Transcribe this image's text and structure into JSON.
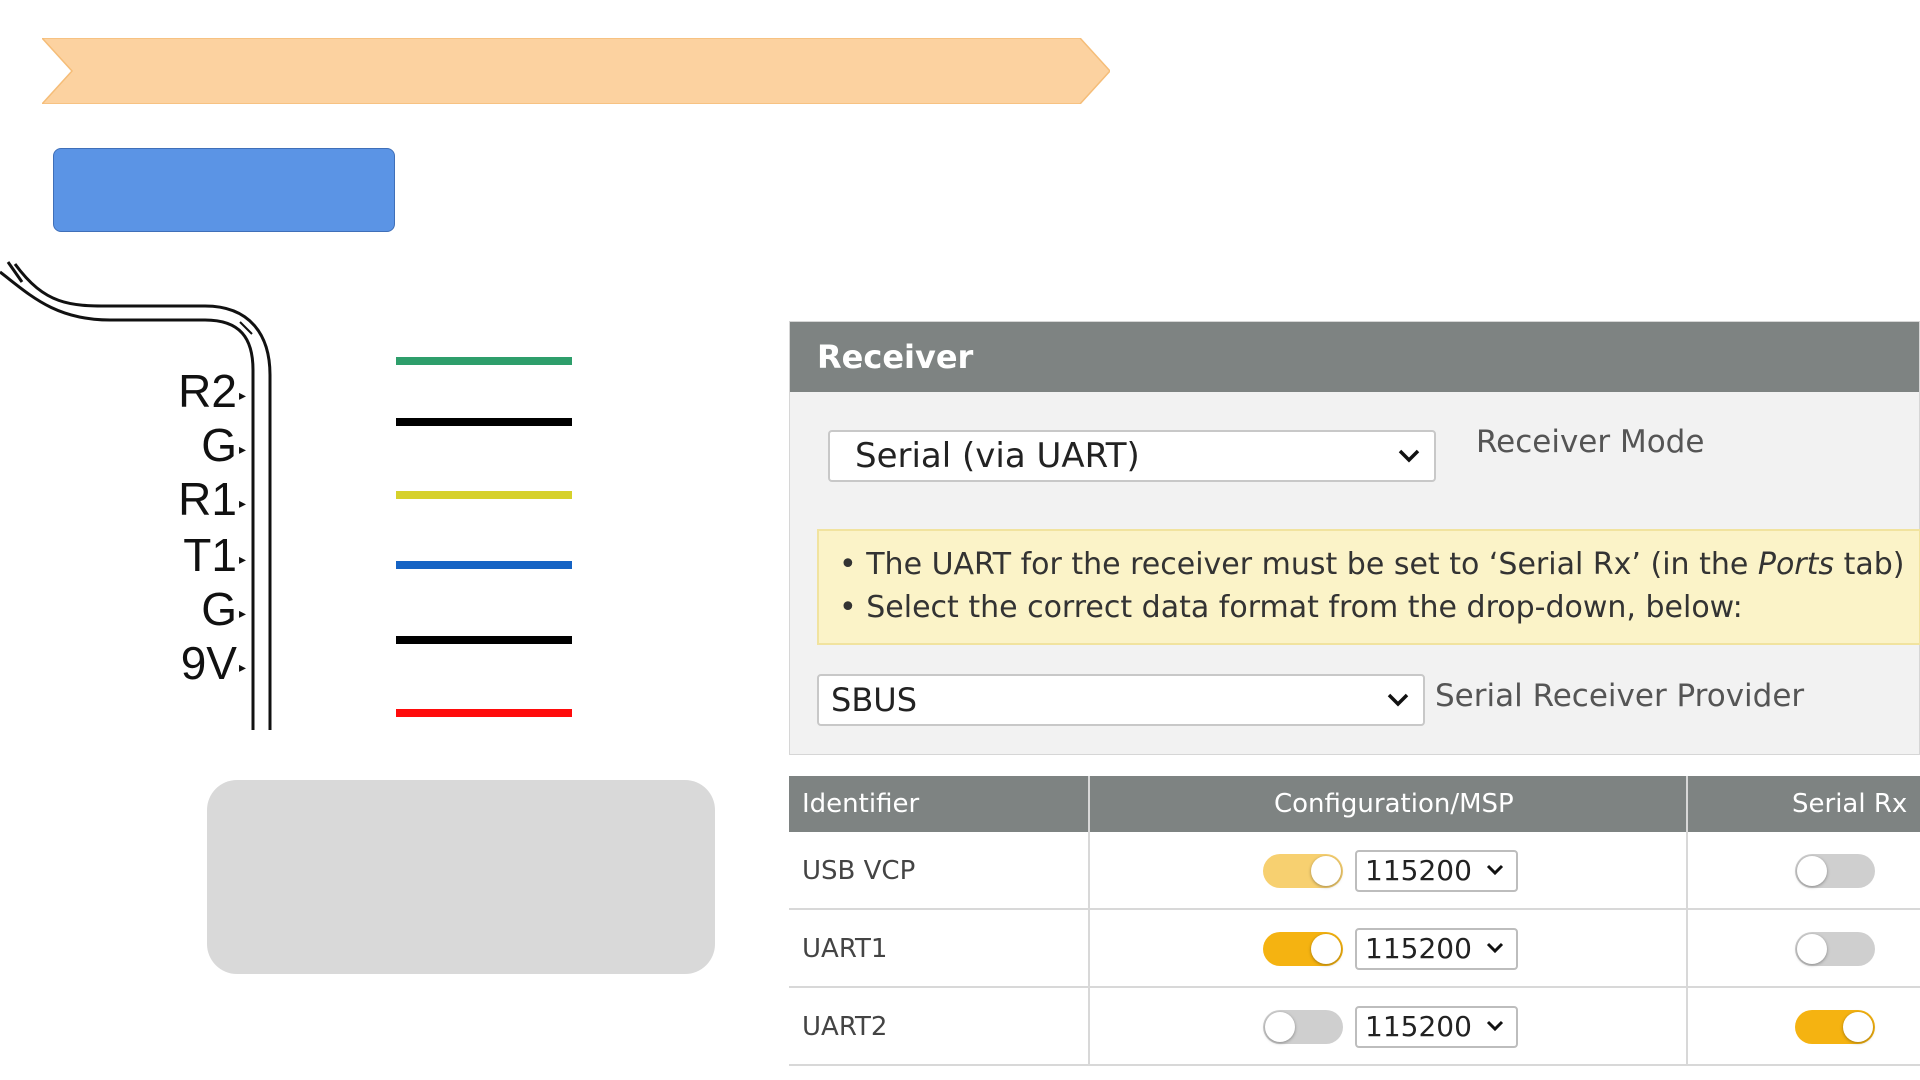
{
  "diagram": {
    "banner_color": "#fcd2a0",
    "blue_box_color": "#5b94e5",
    "gray_box_color": "#d9d9d9",
    "pins": [
      {
        "label": "R2",
        "arrow": "▸",
        "wire_color": "#2e9e6b"
      },
      {
        "label": "G",
        "arrow": "▸",
        "wire_color": "#000000"
      },
      {
        "label": "R1",
        "arrow": "▸",
        "wire_color": "#d6d12b"
      },
      {
        "label": "T1",
        "arrow": "▸",
        "wire_color": "#1563c4"
      },
      {
        "label": "G",
        "arrow": "▸",
        "wire_color": "#000000"
      },
      {
        "label": "9V",
        "arrow": "▸",
        "wire_color": "#ff0b0b"
      }
    ],
    "extra_wire_color": "#ff0b0b"
  },
  "receiver": {
    "title": "Receiver",
    "mode_value": "Serial (via UART)",
    "mode_label": "Receiver Mode",
    "notice_line1_pre": "• The UART for the receiver must be set to ‘Serial Rx’ (in the ",
    "notice_line1_em": "Ports",
    "notice_line1_post": " tab)",
    "notice_line2": "• Select the correct data format from the drop-down, below:",
    "provider_value": "SBUS",
    "provider_label": "Serial Receiver Provider"
  },
  "ports": {
    "headers": {
      "identifier": "Identifier",
      "config": "Configuration/MSP",
      "serial_rx": "Serial Rx"
    },
    "rows": [
      {
        "identifier": "USB VCP",
        "msp_on": true,
        "msp_faded": true,
        "baud": "115200",
        "serial_rx_on": false
      },
      {
        "identifier": "UART1",
        "msp_on": true,
        "msp_faded": false,
        "baud": "115200",
        "serial_rx_on": false
      },
      {
        "identifier": "UART2",
        "msp_on": false,
        "msp_faded": false,
        "baud": "115200",
        "serial_rx_on": true
      }
    ],
    "accent_color": "#f5b311"
  }
}
